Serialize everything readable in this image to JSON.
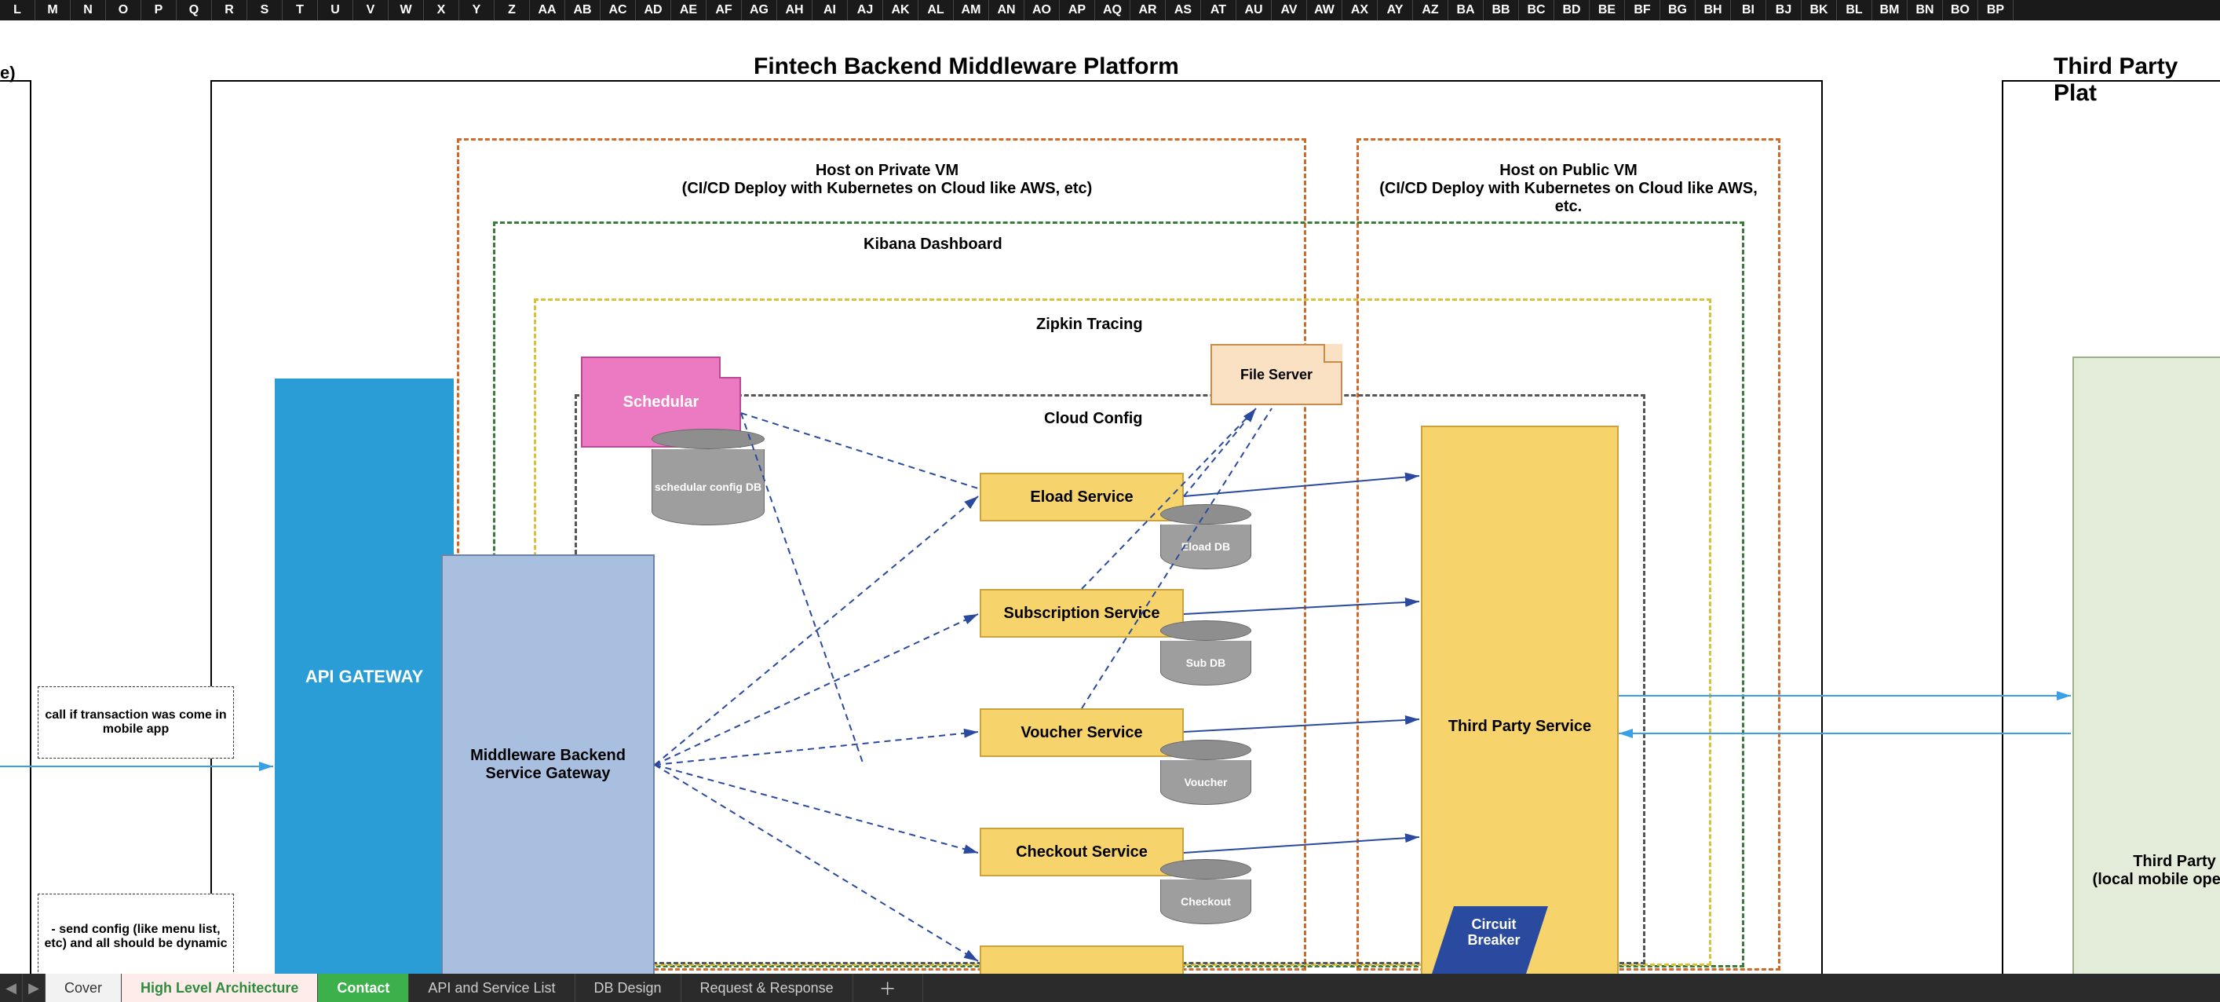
{
  "columns": [
    "L",
    "M",
    "N",
    "O",
    "P",
    "Q",
    "R",
    "S",
    "T",
    "U",
    "V",
    "W",
    "X",
    "Y",
    "Z",
    "AA",
    "AB",
    "AC",
    "AD",
    "AE",
    "AF",
    "AG",
    "AH",
    "AI",
    "AJ",
    "AK",
    "AL",
    "AM",
    "AN",
    "AO",
    "AP",
    "AQ",
    "AR",
    "AS",
    "AT",
    "AU",
    "AV",
    "AW",
    "AX",
    "AY",
    "AZ",
    "BA",
    "BB",
    "BC",
    "BD",
    "BE",
    "BF",
    "BG",
    "BH",
    "BI",
    "BJ",
    "BK",
    "BL",
    "BM",
    "BN",
    "BO",
    "BP"
  ],
  "titles": {
    "left_partial": "e)",
    "main": "Fintech Backend Middleware Platform",
    "right_partial": "Third Party Plat"
  },
  "hosts": {
    "private": {
      "line1": "Host on Private VM",
      "line2": "(CI/CD Deploy with Kubernetes on Cloud like AWS, etc)"
    },
    "public": {
      "line1": "Host on Public VM",
      "line2": "(CI/CD Deploy with Kubernetes on Cloud like AWS, etc."
    }
  },
  "layers": {
    "kibana": "Kibana Dashboard",
    "zipkin": "Zipkin Tracing",
    "cloud_config": "Cloud Config"
  },
  "boxes": {
    "file_server": "File Server",
    "schedular": "Schedular",
    "api_gateway": "API GATEWAY",
    "middleware": "Middleware Backend Service Gateway",
    "eload": "Eload Service",
    "subscription": "Subscription Service",
    "voucher": "Voucher Service",
    "checkout": "Checkout Service",
    "third_party_service": "Third Party Service",
    "circuit_breaker": "Circuit Breaker",
    "third_party_box": "Third Party\n(local mobile operator"
  },
  "dbs": {
    "schedular": "schedular config DB",
    "eload": "Eload DB",
    "sub": "Sub DB",
    "voucher": "Voucher",
    "checkout": "Checkout"
  },
  "notes": {
    "n1": "call if transaction was come in mobile app",
    "n2": "- send config (like menu list, etc) and all should be dynamic"
  },
  "tabs": {
    "cover": "Cover",
    "hla": "High Level Architecture",
    "contact": "Contact",
    "api": "API and Service List",
    "db": "DB Design",
    "rr": "Request & Response"
  }
}
